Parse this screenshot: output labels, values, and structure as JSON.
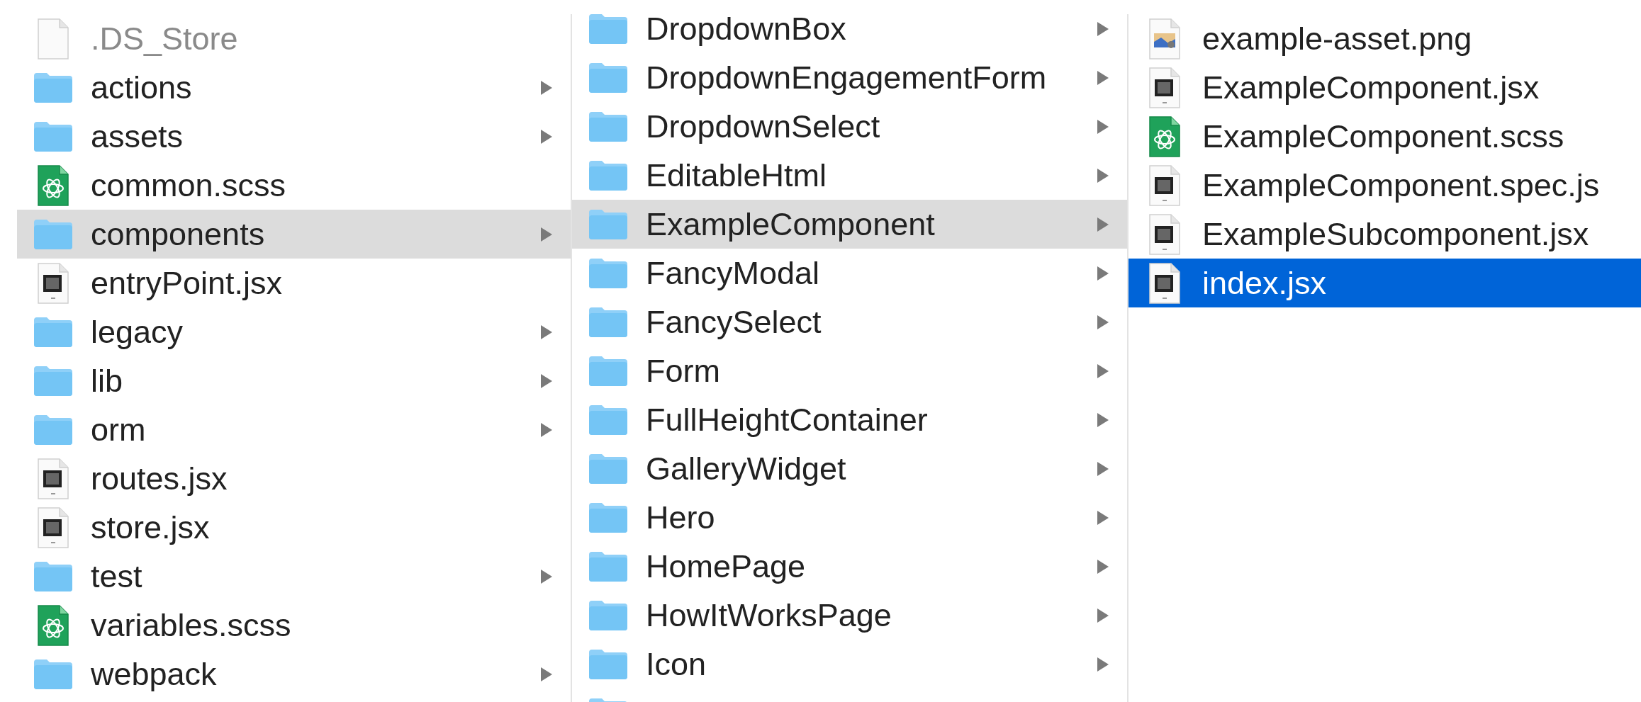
{
  "columns": [
    {
      "focused": false,
      "items": [
        {
          "name": ".DS_Store",
          "kind": "blank",
          "selected": false,
          "dimmed": true
        },
        {
          "name": "actions",
          "kind": "folder",
          "selected": false,
          "dimmed": false
        },
        {
          "name": "assets",
          "kind": "folder",
          "selected": false,
          "dimmed": false
        },
        {
          "name": "common.scss",
          "kind": "scss",
          "selected": false,
          "dimmed": false
        },
        {
          "name": "components",
          "kind": "folder",
          "selected": true,
          "dimmed": false
        },
        {
          "name": "entryPoint.jsx",
          "kind": "js",
          "selected": false,
          "dimmed": false
        },
        {
          "name": "legacy",
          "kind": "folder",
          "selected": false,
          "dimmed": false
        },
        {
          "name": "lib",
          "kind": "folder",
          "selected": false,
          "dimmed": false
        },
        {
          "name": "orm",
          "kind": "folder",
          "selected": false,
          "dimmed": false
        },
        {
          "name": "routes.jsx",
          "kind": "js",
          "selected": false,
          "dimmed": false
        },
        {
          "name": "store.jsx",
          "kind": "js",
          "selected": false,
          "dimmed": false
        },
        {
          "name": "test",
          "kind": "folder",
          "selected": false,
          "dimmed": false
        },
        {
          "name": "variables.scss",
          "kind": "scss",
          "selected": false,
          "dimmed": false
        },
        {
          "name": "webpack",
          "kind": "folder",
          "selected": false,
          "dimmed": false
        }
      ]
    },
    {
      "focused": false,
      "scrolled": true,
      "items": [
        {
          "name": "DropdownBox",
          "kind": "folder",
          "selected": false,
          "dimmed": false
        },
        {
          "name": "DropdownEngagementForm",
          "kind": "folder",
          "selected": false,
          "dimmed": false
        },
        {
          "name": "DropdownSelect",
          "kind": "folder",
          "selected": false,
          "dimmed": false
        },
        {
          "name": "EditableHtml",
          "kind": "folder",
          "selected": false,
          "dimmed": false
        },
        {
          "name": "ExampleComponent",
          "kind": "folder",
          "selected": true,
          "dimmed": false
        },
        {
          "name": "FancyModal",
          "kind": "folder",
          "selected": false,
          "dimmed": false
        },
        {
          "name": "FancySelect",
          "kind": "folder",
          "selected": false,
          "dimmed": false
        },
        {
          "name": "Form",
          "kind": "folder",
          "selected": false,
          "dimmed": false
        },
        {
          "name": "FullHeightContainer",
          "kind": "folder",
          "selected": false,
          "dimmed": false
        },
        {
          "name": "GalleryWidget",
          "kind": "folder",
          "selected": false,
          "dimmed": false
        },
        {
          "name": "Hero",
          "kind": "folder",
          "selected": false,
          "dimmed": false
        },
        {
          "name": "HomePage",
          "kind": "folder",
          "selected": false,
          "dimmed": false
        },
        {
          "name": "HowItWorksPage",
          "kind": "folder",
          "selected": false,
          "dimmed": false
        },
        {
          "name": "Icon",
          "kind": "folder",
          "selected": false,
          "dimmed": false
        },
        {
          "kind": "folder",
          "selected": false,
          "dimmed": false
        }
      ]
    },
    {
      "focused": true,
      "items": [
        {
          "name": "example-asset.png",
          "kind": "image",
          "selected": false,
          "dimmed": false
        },
        {
          "name": "ExampleComponent.jsx",
          "kind": "js",
          "selected": false,
          "dimmed": false
        },
        {
          "name": "ExampleComponent.scss",
          "kind": "scss",
          "selected": false,
          "dimmed": false
        },
        {
          "name": "ExampleComponent.spec.js",
          "kind": "js",
          "selected": false,
          "dimmed": false
        },
        {
          "name": "ExampleSubcomponent.jsx",
          "kind": "js",
          "selected": false,
          "dimmed": false
        },
        {
          "name": "index.jsx",
          "kind": "js",
          "selected": true,
          "dimmed": false
        }
      ]
    }
  ]
}
